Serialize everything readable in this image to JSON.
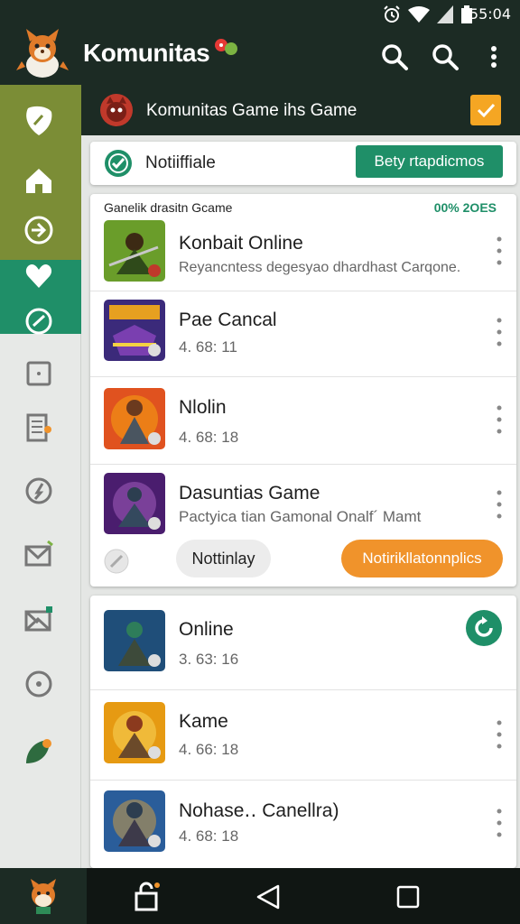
{
  "status_bar": {
    "time": "55:04",
    "icons": [
      "alarm-icon",
      "wifi-icon",
      "signal-icon",
      "battery-icon"
    ]
  },
  "app_bar": {
    "title": "Komunitas",
    "actions": [
      "search-icon",
      "search-icon",
      "more-vert-icon"
    ]
  },
  "sidebar": {
    "items": [
      "leaf-icon",
      "home-icon",
      "download-icon",
      "heart-icon",
      "check-circle-icon",
      "square-icon",
      "document-icon",
      "compass-icon",
      "mail-icon",
      "mail-badge-icon",
      "circle-icon",
      "leaf-notification-icon"
    ]
  },
  "banner": {
    "text": "Komunitas Game ihs Game"
  },
  "notification": {
    "title": "Notiiffiale",
    "button": "Bety rtapdicmos"
  },
  "section": {
    "label": "Ganelik drasitn Gcame",
    "count": "00% 2OES",
    "rows": [
      {
        "title": "Konbait Online",
        "subtitle": "Reyancntess degesyao dhardhast Carqone."
      },
      {
        "title": "Pae Cancal",
        "subtitle": "4. 68: 11"
      },
      {
        "title": "Nlolin",
        "subtitle": "4. 68: 18"
      },
      {
        "title": "Dasuntias Game",
        "subtitle": "Pactyica tian Gamonal Onalf´ Mamt"
      }
    ],
    "actions": {
      "secondary": "Nottinlay",
      "primary": "Notirikllatonnplics"
    }
  },
  "list2": {
    "rows": [
      {
        "title": "Online",
        "subtitle": "3. 63: 16"
      },
      {
        "title": "Kame",
        "subtitle": "4. 66: 18"
      },
      {
        "title": "Nohase‥ Canellra)",
        "subtitle": "4. 68: 18"
      }
    ]
  },
  "nav_bar": {
    "icons": [
      "mascot-icon",
      "lock-icon",
      "back-icon",
      "recents-icon"
    ]
  },
  "colors": {
    "dark": "#1c2b24",
    "olive": "#7b8d36",
    "teal": "#1f8f68",
    "orange": "#f0932b",
    "amber": "#f5a623"
  }
}
